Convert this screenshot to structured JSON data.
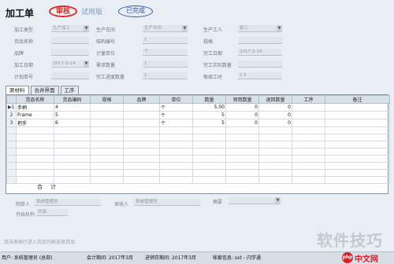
{
  "header": {
    "title": "加工单",
    "stamp_review": "审核",
    "trial": "试用版",
    "stamp_done": "已完成"
  },
  "form": {
    "row1": [
      {
        "label": "加工类型",
        "value": "生产加工"
      },
      {
        "label": "生产车间",
        "value": "生产车间"
      },
      {
        "label": "生产工人",
        "value": "张三"
      }
    ],
    "row2": [
      {
        "label": "货品名称",
        "value": ""
      },
      {
        "label": "结构编号",
        "value": "1"
      },
      {
        "label": "规格",
        "value": ""
      }
    ],
    "row3": [
      {
        "label": "品牌",
        "value": ""
      },
      {
        "label": "计量单位",
        "value": "个"
      },
      {
        "label": "完工日期",
        "value": "2017-3-14"
      }
    ],
    "row4": [
      {
        "label": "加工日期",
        "value": "2017-3-14"
      },
      {
        "label": "需求数量",
        "value": "1"
      },
      {
        "label": "完工实际数量",
        "value": ""
      }
    ],
    "row5": [
      {
        "label": "计划单号",
        "value": ""
      },
      {
        "label": "完工进度数量",
        "value": "1"
      },
      {
        "label": "每周工时",
        "value": "1.5"
      }
    ]
  },
  "tabs": [
    "原材料",
    "合并界面",
    "工序"
  ],
  "grid": {
    "headers": [
      "",
      "货品名称",
      "货品编码",
      "规格",
      "品牌",
      "单位",
      "数量",
      "领用数量",
      "退回数量",
      "工序",
      "备注"
    ],
    "rows": [
      {
        "no": "1",
        "name": "手柄",
        "code": "4",
        "spec": "",
        "brand": "",
        "unit": "个",
        "qty": "5.00",
        "used": "0",
        "returned": "0",
        "process": "",
        "note": ""
      },
      {
        "no": "2",
        "name": "Frame",
        "code": "5",
        "spec": "",
        "brand": "",
        "unit": "个",
        "qty": "5",
        "used": "0",
        "returned": "0",
        "process": "",
        "note": ""
      },
      {
        "no": "3",
        "name": "把手",
        "code": "6",
        "spec": "",
        "brand": "",
        "unit": "个",
        "qty": "5",
        "used": "0",
        "returned": "0",
        "process": "",
        "note": ""
      }
    ],
    "total_label": "合 计"
  },
  "footer": {
    "maker_label": "制单人",
    "maker_value": "系统管理员",
    "auditor_label": "审核人",
    "auditor_value": "系统管理员",
    "remark_label": "摘要",
    "approver_label": "开始机构",
    "approver_value": "总部",
    "hint": "双击表格行进入货品列表选择货品"
  },
  "status": {
    "user": "用户: 系统管理员 (总部)",
    "period": "会计期间: 2017年3月",
    "period2": "进销存期间: 2017年3月",
    "account": "帐套信息: sxt - 闪学通"
  },
  "watermark": {
    "text": "软件技巧",
    "logo_circle": "php",
    "logo_word": "中文网"
  },
  "colors": {
    "stamp_red": "#d62c2c",
    "stamp_blue": "#3355aa",
    "background": "#e8eef4"
  }
}
